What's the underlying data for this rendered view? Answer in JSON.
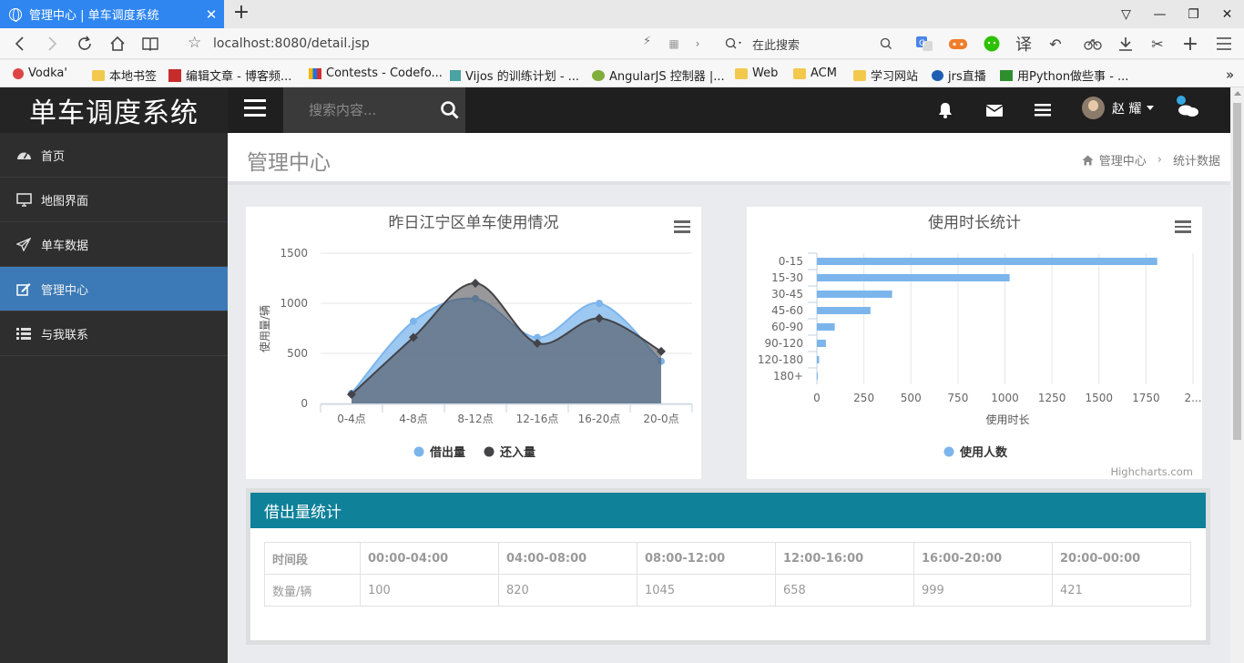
{
  "browser": {
    "tab_title": "管理中心 | 单车调度系统",
    "url": "localhost:8080/detail.jsp",
    "search_placeholder": "在此搜索",
    "bookmarks": [
      "Vodka'",
      "本地书签",
      "编辑文章 - 博客频...",
      "Contests - Codefo...",
      "Vijos 的训练计划 - ...",
      "AngularJS 控制器 |...",
      "Web",
      "ACM",
      "学习网站",
      "jrs直播",
      "用Python做些事 - ..."
    ]
  },
  "app": {
    "brand": "单车调度系统",
    "search_placeholder": "搜索内容...",
    "user_name": "赵 耀"
  },
  "sidebar": {
    "items": [
      {
        "label": "首页",
        "icon": "dashboard-icon"
      },
      {
        "label": "地图界面",
        "icon": "desktop-icon"
      },
      {
        "label": "单车数据",
        "icon": "paper-plane-icon"
      },
      {
        "label": "管理中心",
        "icon": "edit-icon",
        "active": true
      },
      {
        "label": "与我联系",
        "icon": "list-icon"
      }
    ]
  },
  "page": {
    "title": "管理中心",
    "breadcrumb": [
      "管理中心",
      "统计数据"
    ]
  },
  "chart_data": [
    {
      "type": "area",
      "title": "昨日江宁区单车使用情况",
      "ylabel": "使用量/辆",
      "categories": [
        "0-4点",
        "4-8点",
        "8-12点",
        "12-16点",
        "16-20点",
        "20-0点"
      ],
      "ylim": [
        0,
        1500
      ],
      "yticks": [
        0,
        500,
        1000,
        1500
      ],
      "series": [
        {
          "name": "借出量",
          "color": "#7cb5ec",
          "values": [
            100,
            820,
            1045,
            658,
            999,
            421
          ]
        },
        {
          "name": "还入量",
          "color": "#434348",
          "values": [
            90,
            660,
            1200,
            600,
            850,
            520
          ]
        }
      ],
      "legend": "bottom"
    },
    {
      "type": "bar",
      "title": "使用时长统计",
      "xlabel": "使用时长",
      "categories": [
        "0-15",
        "15-30",
        "30-45",
        "45-60",
        "60-90",
        "90-120",
        "120-180",
        "180+"
      ],
      "xticks": [
        "0",
        "250",
        "500",
        "750",
        "1000",
        "1250",
        "1500",
        "1750",
        "2..."
      ],
      "xlim": [
        0,
        2000
      ],
      "series": [
        {
          "name": "使用人数",
          "color": "#7cb5ec",
          "values": [
            1810,
            1025,
            400,
            285,
            95,
            48,
            12,
            3
          ]
        }
      ],
      "credits": "Highcharts.com",
      "legend": "bottom"
    }
  ],
  "table": {
    "title": "借出量统计",
    "headers": [
      "时间段",
      "00:00-04:00",
      "04:00-08:00",
      "08:00-12:00",
      "12:00-16:00",
      "16:00-20:00",
      "20:00-00:00"
    ],
    "row": [
      "数量/辆",
      "100",
      "820",
      "1045",
      "658",
      "999",
      "421"
    ]
  }
}
